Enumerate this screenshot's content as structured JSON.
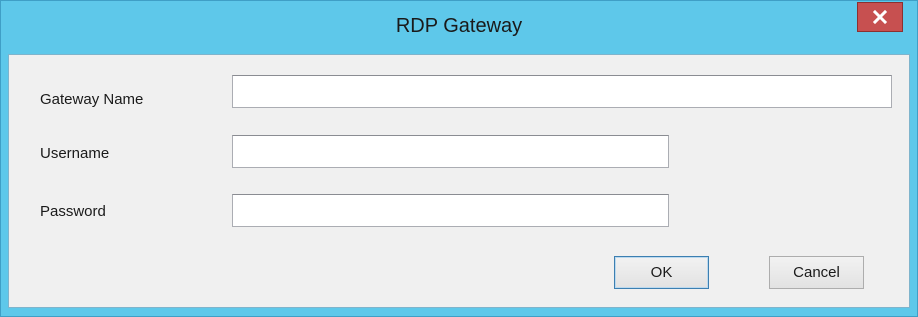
{
  "window": {
    "title": "RDP Gateway"
  },
  "form": {
    "gateway_name": {
      "label": "Gateway Name",
      "value": ""
    },
    "username": {
      "label": "Username",
      "value": ""
    },
    "password": {
      "label": "Password",
      "value": ""
    }
  },
  "buttons": {
    "ok_label": "OK",
    "cancel_label": "Cancel"
  },
  "icons": {
    "close": "close-icon"
  },
  "colors": {
    "titlebar": "#5ec8ea",
    "close_button": "#c75050",
    "client_background": "#f0f0f0",
    "default_button_border": "#3c7fb1"
  }
}
